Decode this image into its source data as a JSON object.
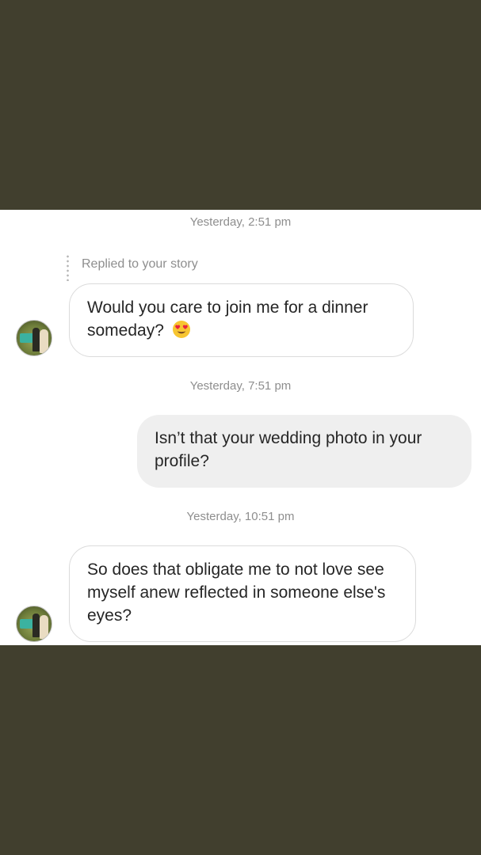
{
  "conversation": {
    "messages": [
      {
        "timestamp": "Yesterday, 2:51 pm",
        "reply_label": "Replied to your story",
        "text": "Would you care to join me for a dinner someday?",
        "emoji": "😍",
        "emoji_name": "heart-eyes-emoji"
      },
      {
        "timestamp": "Yesterday, 7:51 pm",
        "text": "Isn’t that your wedding photo in your profile?"
      },
      {
        "timestamp": "Yesterday, 10:51 pm",
        "text": "So does that obligate me to not love see myself anew reflected in someone else's eyes?"
      }
    ]
  },
  "colors": {
    "background_band": "#413f2e",
    "chat_background": "#ffffff",
    "outgoing_bubble": "#efefef",
    "incoming_border": "#dbdbdb",
    "timestamp_text": "#8e8e8e",
    "message_text": "#262626"
  }
}
